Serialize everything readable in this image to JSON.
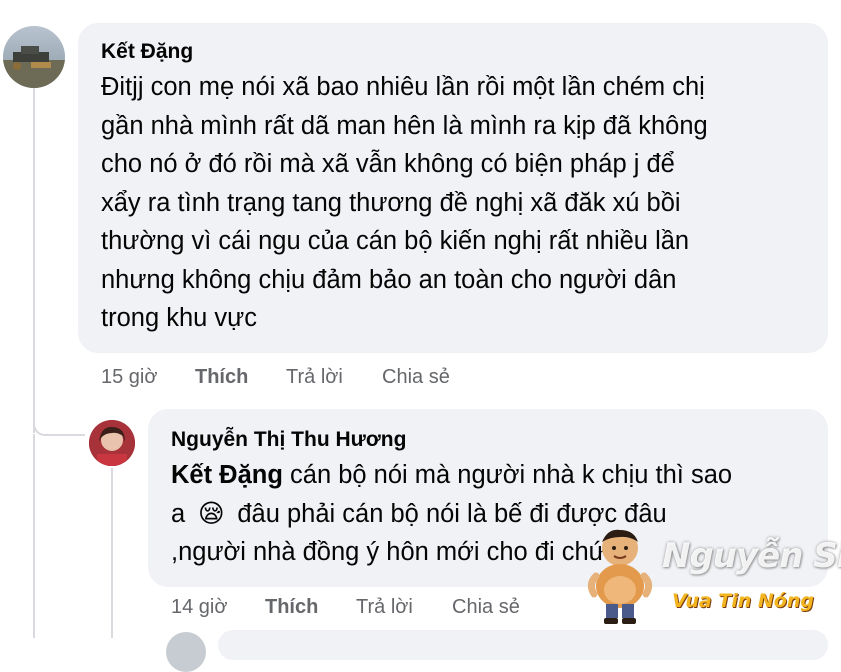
{
  "comments": [
    {
      "author": "Kết Đặng",
      "lines": [
        "Đitjj con mẹ nói xã bao nhiêu lần rồi một lần chém chị",
        "gần nhà mình rất dã man hên là mình ra kịp đã không",
        "cho nó ở đó rồi mà xã vẫn không có biện pháp j để",
        "xẩy ra tình trạng tang thương đề nghị xã đăk xú bồi",
        "thường vì cái ngu của cán bộ kiến nghị rất nhiều lần",
        "nhưng không chịu đảm bảo an toàn cho người dân",
        "trong khu vực"
      ],
      "time": "15 giờ",
      "like_label": "Thích",
      "reply_label": "Trả lời",
      "share_label": "Chia sẻ"
    },
    {
      "author": "Nguyễn Thị Thu Hương",
      "mention": "Kết Đặng",
      "line1_rest": " cán bộ nói mà người nhà k chịu thì sao",
      "line2_a": "a ",
      "emoji": "😪",
      "line2_b": " đâu phải cán bộ nói là bế đi được đâu",
      "line3": ",người nhà đồng ý hôn mới cho đi chứ",
      "time": "14 giờ",
      "like_label": "Thích",
      "reply_label": "Trả lời",
      "share_label": "Chia sẻ"
    }
  ],
  "watermark": {
    "name": "Nguyễn Sin",
    "tagline": "Vua Tin Nóng"
  }
}
